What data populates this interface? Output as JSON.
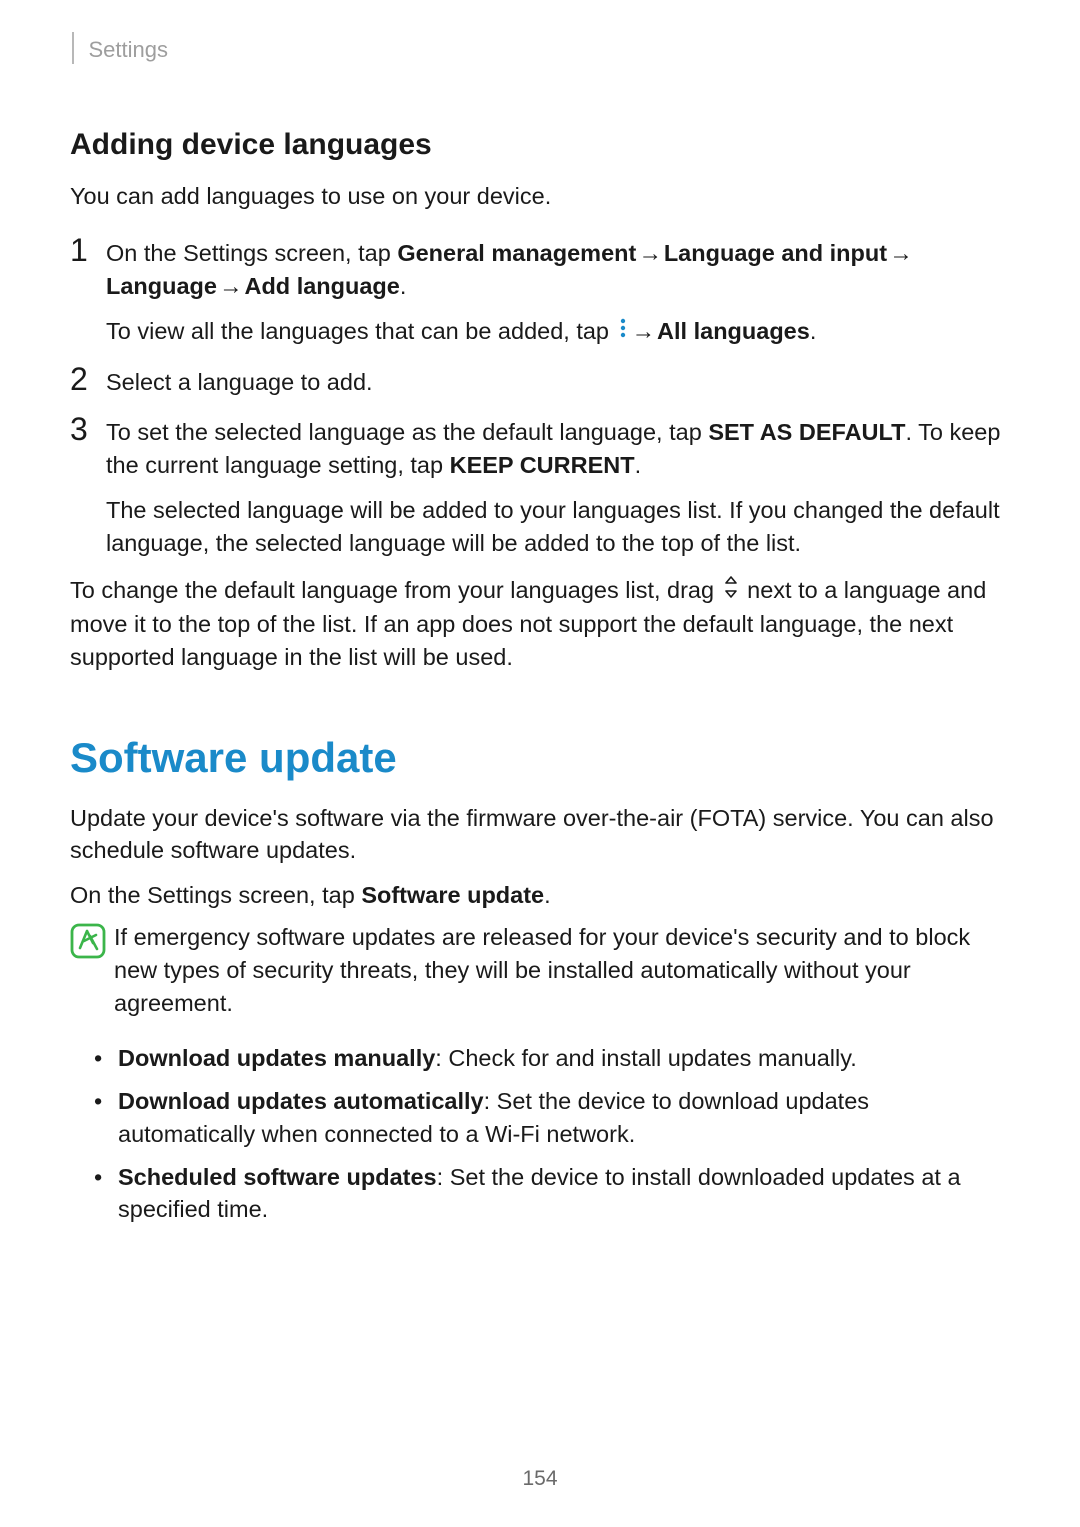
{
  "header": {
    "breadcrumb": "Settings"
  },
  "section1": {
    "title": "Adding device languages",
    "intro": "You can add languages to use on your device.",
    "step1": {
      "num": "1",
      "pre": "On the Settings screen, tap ",
      "b1": "General management",
      "arr1": " → ",
      "b2": "Language and input",
      "arr2": " → ",
      "b3": "Language",
      "arr3": " → ",
      "b4": "Add language",
      "period": ".",
      "sub_pre": "To view all the languages that can be added, tap ",
      "sub_arr": " → ",
      "sub_b": "All languages",
      "sub_period": "."
    },
    "step2": {
      "num": "2",
      "text": "Select a language to add."
    },
    "step3": {
      "num": "3",
      "pre": "To set the selected language as the default language, tap ",
      "b1": "SET AS DEFAULT",
      "mid": ". To keep the current language setting, tap ",
      "b2": "KEEP CURRENT",
      "period": ".",
      "sub": "The selected language will be added to your languages list. If you changed the default language, the selected language will be added to the top of the list."
    },
    "after_pre": "To change the default language from your languages list, drag ",
    "after_post": " next to a language and move it to the top of the list. If an app does not support the default language, the next supported language in the list will be used."
  },
  "section2": {
    "title": "Software update",
    "intro": "Update your device's software via the firmware over-the-air (FOTA) service. You can also schedule software updates.",
    "nav_pre": "On the Settings screen, tap ",
    "nav_b": "Software update",
    "nav_period": ".",
    "note": "If emergency software updates are released for your device's security and to block new types of security threats, they will be installed automatically without your agreement.",
    "bullets": [
      {
        "b": "Download updates manually",
        "rest": ": Check for and install updates manually."
      },
      {
        "b": "Download updates automatically",
        "rest": ": Set the device to download updates automatically when connected to a Wi-Fi network."
      },
      {
        "b": "Scheduled software updates",
        "rest": ": Set the device to install downloaded updates at a specified time."
      }
    ]
  },
  "page_number": "154",
  "bullet_char": "•"
}
